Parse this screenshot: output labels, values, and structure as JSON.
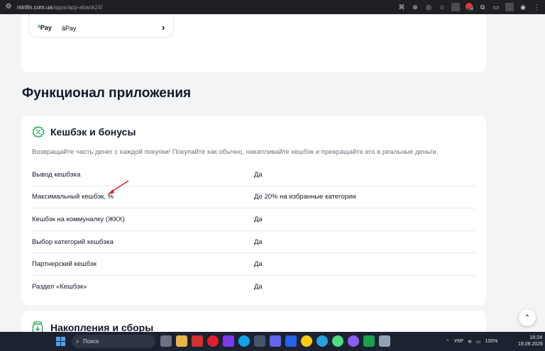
{
  "browser": {
    "url_host": "minfin.com.ua",
    "url_path": "/apps/app-abank24/",
    "extension_badge": "14"
  },
  "top_card": {
    "pay_logo": "Pay",
    "pay_name": "âPay"
  },
  "section_title": "Функционал приложения",
  "cashback": {
    "title": "Кешбэк и бонусы",
    "description": "Возвращайте часть денег с каждой покупки! Покупайте как обычно, накапливайте кешбэк и превращайте его в реальные деньги.",
    "rows": [
      {
        "label": "Вывод кешбэка",
        "value": "Да"
      },
      {
        "label": "Максимальный кешбэк, %",
        "value": "До 20% на избранные категории"
      },
      {
        "label": "Кешбэк на коммуналку (ЖКХ)",
        "value": "Да"
      },
      {
        "label": "Выбор категорий кешбэка",
        "value": "Да"
      },
      {
        "label": "Партнерский кешбэк",
        "value": "Да"
      },
      {
        "label": "Раздел «Кешбэк»",
        "value": "Да"
      }
    ]
  },
  "savings": {
    "title": "Накопления и сборы"
  },
  "taskbar": {
    "search_placeholder": "Поиск",
    "language": "УКР",
    "battery": "100%",
    "time": "16:24",
    "date": "19.08.2026"
  },
  "colors": {
    "accent": "#16a34a",
    "arrow": "#e11d2e",
    "taskbar": "#1c2230"
  }
}
